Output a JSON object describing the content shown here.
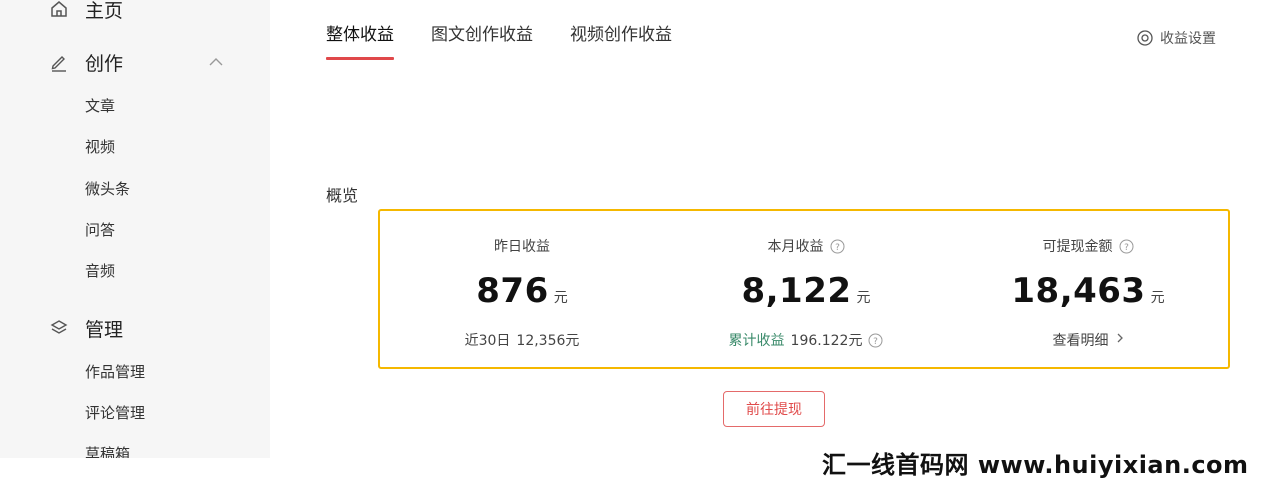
{
  "sidebar": {
    "home": {
      "label": "主页",
      "icon": "home-icon"
    },
    "create": {
      "label": "创作",
      "icon": "pencil-icon",
      "items": [
        {
          "label": "文章"
        },
        {
          "label": "视频"
        },
        {
          "label": "微头条"
        },
        {
          "label": "问答"
        },
        {
          "label": "音频"
        }
      ]
    },
    "manage": {
      "label": "管理",
      "icon": "layers-icon",
      "items": [
        {
          "label": "作品管理"
        },
        {
          "label": "评论管理"
        },
        {
          "label": "草稿箱"
        }
      ]
    }
  },
  "tabs": [
    {
      "label": "整体收益",
      "active": true
    },
    {
      "label": "图文创作收益",
      "active": false
    },
    {
      "label": "视频创作收益",
      "active": false
    }
  ],
  "settings": {
    "label": "收益设置",
    "icon": "target-icon"
  },
  "overview": {
    "title": "概览",
    "metrics": [
      {
        "label": "昨日收益",
        "value": "876",
        "unit": "元",
        "sub_label": "近30日",
        "sub_value": "12,356元"
      },
      {
        "label": "本月收益",
        "value": "8,122",
        "unit": "元",
        "sub_label": "累计收益",
        "sub_value": "196.122元"
      },
      {
        "label": "可提现金额",
        "value": "18,463",
        "unit": "元",
        "link_label": "查看明细"
      }
    ],
    "withdraw_button": "前往提现"
  },
  "watermark": "汇一线首码网 www.huiyixian.com",
  "colors": {
    "accent_red": "#e0484a",
    "highlight_border": "#f5b800",
    "accent_green": "#3a8a6a",
    "sidebar_bg": "#f6f6f6"
  }
}
